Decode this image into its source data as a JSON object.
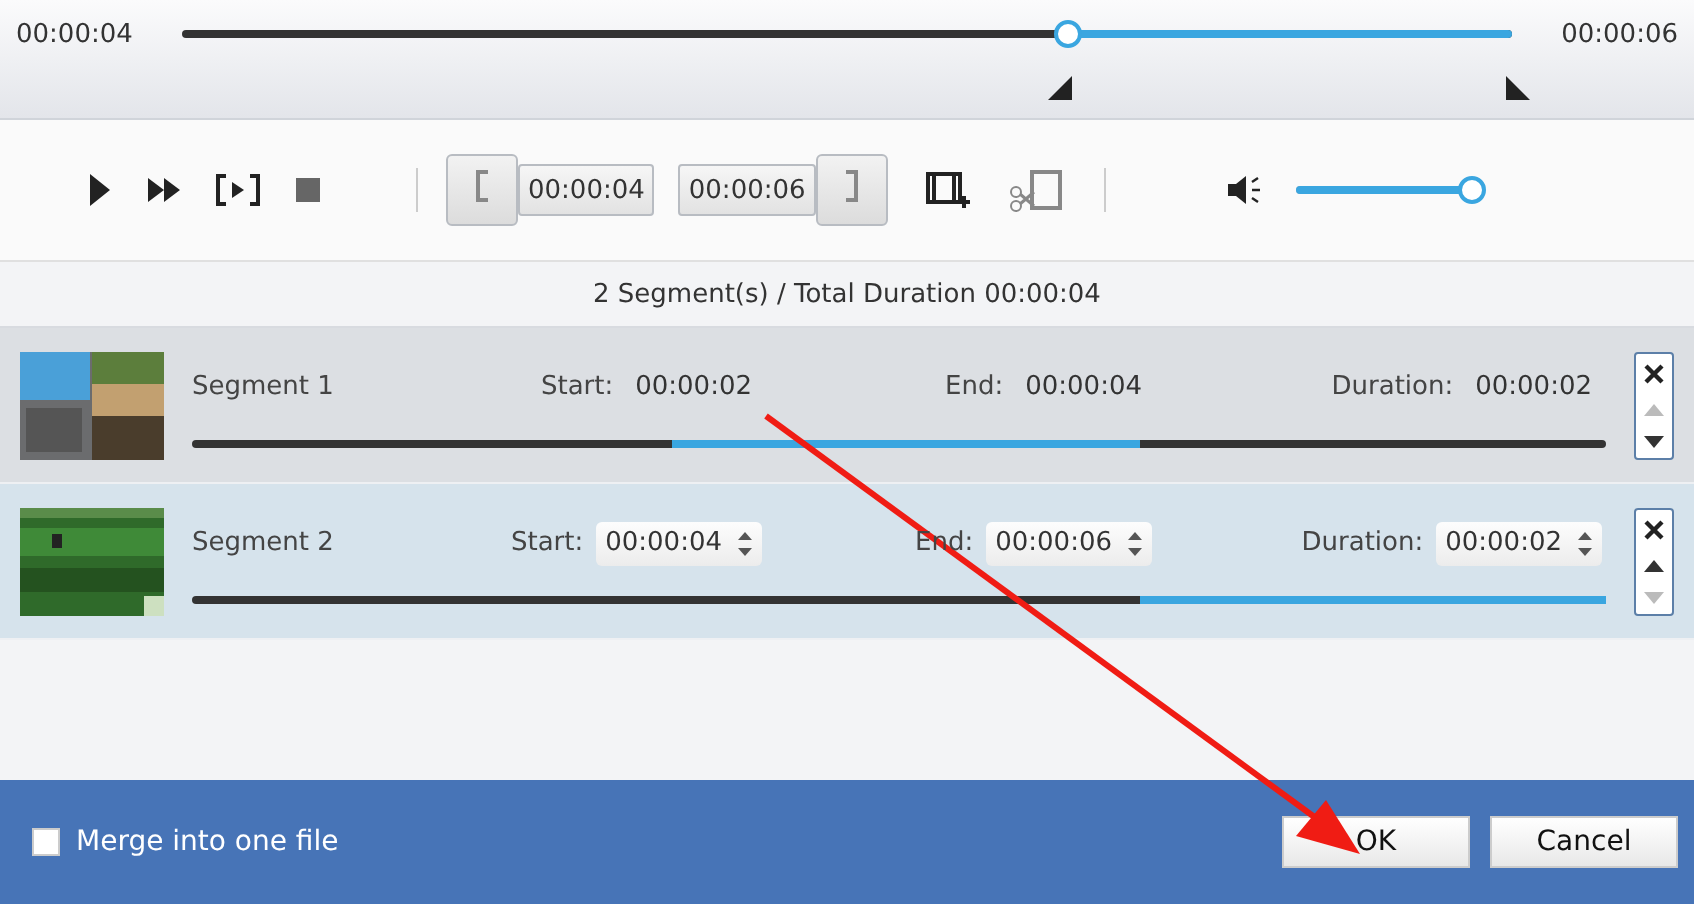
{
  "timeline": {
    "start_time": "00:00:04",
    "end_time": "00:00:06",
    "level": 0.667
  },
  "controls": {
    "mark_in": "00:00:04",
    "mark_out": "00:00:06",
    "volume": {
      "level": 1
    }
  },
  "summary": "2 Segment(s) / Total Duration 00:00:04",
  "segments": [
    {
      "name": "Segment 1",
      "selected": false,
      "start_label": "Start:",
      "start": "00:00:02",
      "end_label": "End:",
      "end": "00:00:04",
      "duration_label": "Duration:",
      "duration": "00:00:02",
      "up_disabled": true,
      "down_disabled": false
    },
    {
      "name": "Segment 2",
      "selected": true,
      "start_label": "Start:",
      "start": "00:00:04",
      "end_label": "End:",
      "end": "00:00:06",
      "duration_label": "Duration:",
      "duration": "00:00:02",
      "up_disabled": false,
      "down_disabled": true
    }
  ],
  "merge": {
    "label": "Merge into one file",
    "checked": false
  },
  "buttons": [
    "OK",
    "Cancel"
  ]
}
